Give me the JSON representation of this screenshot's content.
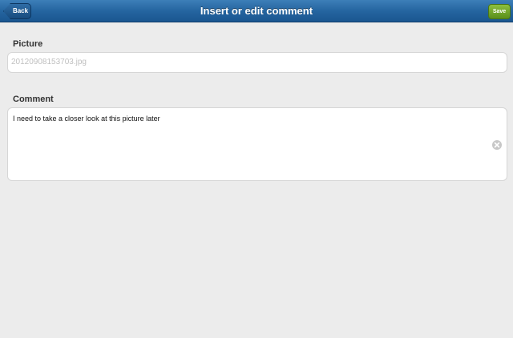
{
  "navbar": {
    "title": "Insert or edit comment",
    "back_label": "Back",
    "save_label": "Save"
  },
  "picture": {
    "label": "Picture",
    "value": "20120908153703.jpg"
  },
  "comment": {
    "label": "Comment",
    "value": "I need to take a closer look at this picture later",
    "clear_icon": "clear-icon"
  },
  "colors": {
    "navbar": "#2565a0",
    "save_button": "#6fa52a",
    "background": "#ececec"
  }
}
